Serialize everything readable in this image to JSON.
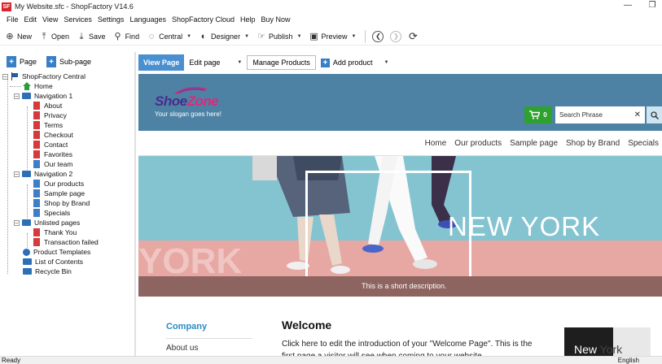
{
  "window": {
    "title": "My Website.sfc - ShopFactory V14.6",
    "app_icon": "SF"
  },
  "menu": [
    "File",
    "Edit",
    "View",
    "Services",
    "Settings",
    "Languages",
    "ShopFactory Cloud",
    "Help",
    "Buy Now"
  ],
  "toolbar": {
    "new": "New",
    "open": "Open",
    "save": "Save",
    "find": "Find",
    "central": "Central",
    "designer": "Designer",
    "publish": "Publish",
    "preview": "Preview"
  },
  "left_panel": {
    "page_btn": "Page",
    "subpage_btn": "Sub-page",
    "tree": {
      "root": "ShopFactory Central",
      "home": "Home",
      "nav1": "Navigation 1",
      "nav1_items": [
        "About",
        "Privacy",
        "Terms",
        "Checkout",
        "Contact",
        "Favorites",
        "Our team"
      ],
      "nav2": "Navigation 2",
      "nav2_items": [
        "Our products",
        "Sample page",
        "Shop by Brand",
        "Specials"
      ],
      "unlisted": "Unlisted pages",
      "unlisted_items": [
        "Thank You",
        "Transaction failed"
      ],
      "templates": "Product Templates",
      "contents": "List of Contents",
      "recycle": "Recycle Bin"
    }
  },
  "tabs": {
    "view_page": "View Page",
    "edit_page": "Edit page",
    "manage_products": "Manage Products",
    "add_product": "Add product"
  },
  "site": {
    "logo_a": "Shoe",
    "logo_b": "Zone",
    "slogan": "Your slogan goes here!",
    "cart_count": "0",
    "search_placeholder": "Search Phrase",
    "nav": [
      "Home",
      "Our products",
      "Sample page",
      "Shop by Brand",
      "Specials"
    ],
    "hero_title": "NEW YORK",
    "hero_ghost": "YORK",
    "hero_desc": "This is a short description.",
    "side_company": "Company",
    "side_about": "About us",
    "welcome": "Welcome",
    "intro": "Click here to edit the introduction of your \"Welcome Page\". This is the first page a visitor will see when coming to your website.",
    "thumb_a": "New",
    "thumb_b": "York"
  },
  "status": {
    "left": "Ready",
    "right": "English"
  },
  "colors": {
    "accent": "#4a8fcf",
    "header": "#4d82a5",
    "hero": "#84c4d0",
    "cart": "#2fa12f",
    "link": "#2b8ac6"
  }
}
